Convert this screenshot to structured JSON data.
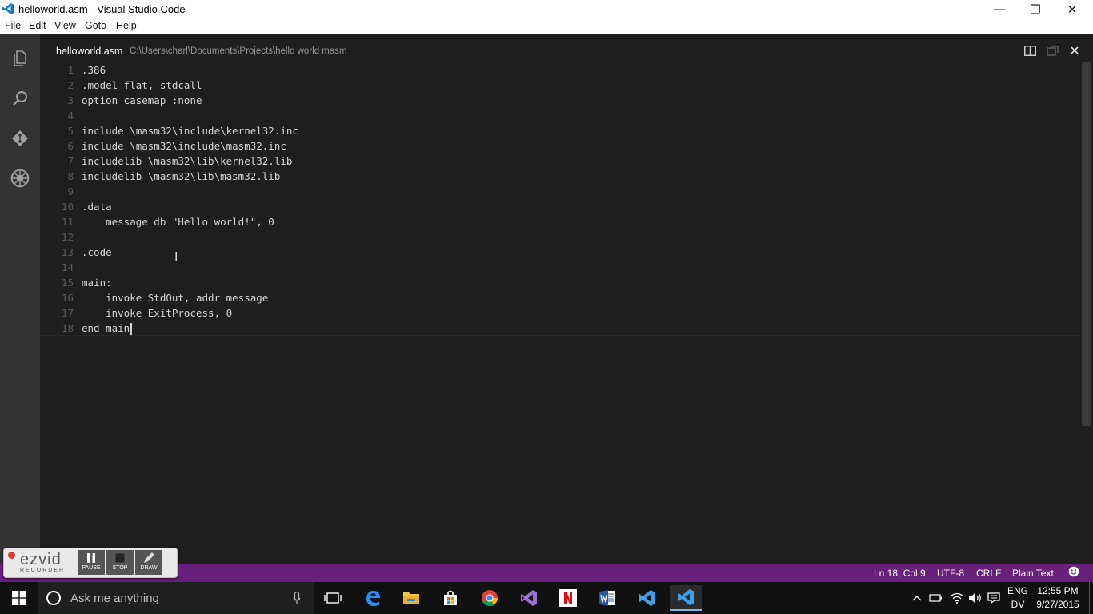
{
  "window": {
    "title": "helloworld.asm - Visual Studio Code",
    "minimize": "—",
    "restore": "❐",
    "close": "✕"
  },
  "menu": {
    "file": "File",
    "edit": "Edit",
    "view": "View",
    "goto": "Goto",
    "help": "Help"
  },
  "editor": {
    "filename": "helloworld.asm",
    "path": "C:\\Users\\charl\\Documents\\Projects\\hello world masm",
    "lines": [
      {
        "n": "1",
        "text": ".386"
      },
      {
        "n": "2",
        "text": ".model flat, stdcall"
      },
      {
        "n": "3",
        "text": "option casemap :none"
      },
      {
        "n": "4",
        "text": ""
      },
      {
        "n": "5",
        "text": "include \\masm32\\include\\kernel32.inc"
      },
      {
        "n": "6",
        "text": "include \\masm32\\include\\masm32.inc"
      },
      {
        "n": "7",
        "text": "includelib \\masm32\\lib\\kernel32.lib"
      },
      {
        "n": "8",
        "text": "includelib \\masm32\\lib\\masm32.lib"
      },
      {
        "n": "9",
        "text": ""
      },
      {
        "n": "10",
        "text": ".data"
      },
      {
        "n": "11",
        "text": "    message db \"Hello world!\", 0"
      },
      {
        "n": "12",
        "text": ""
      },
      {
        "n": "13",
        "text": ".code"
      },
      {
        "n": "14",
        "text": ""
      },
      {
        "n": "15",
        "text": "main:"
      },
      {
        "n": "16",
        "text": "    invoke StdOut, addr message"
      },
      {
        "n": "17",
        "text": "    invoke ExitProcess, 0"
      },
      {
        "n": "18",
        "text": "end main"
      }
    ]
  },
  "statusbar": {
    "position": "Ln 18, Col 9",
    "encoding": "UTF-8",
    "eol": "CRLF",
    "language": "Plain Text"
  },
  "ezvid": {
    "logo": "ezvid",
    "sub": "RECORDER",
    "pause": "PAUSE",
    "stop": "STOP",
    "draw": "DRAW"
  },
  "taskbar": {
    "search_placeholder": "Ask me anything",
    "lang_line1": "ENG",
    "lang_line2": "DV",
    "time": "12:55 PM",
    "date": "9/27/2015"
  },
  "colors": {
    "statusbar": "#68217a",
    "activitybar": "#333333",
    "editor_bg": "#1e1e1e",
    "accent": "#007acc"
  }
}
